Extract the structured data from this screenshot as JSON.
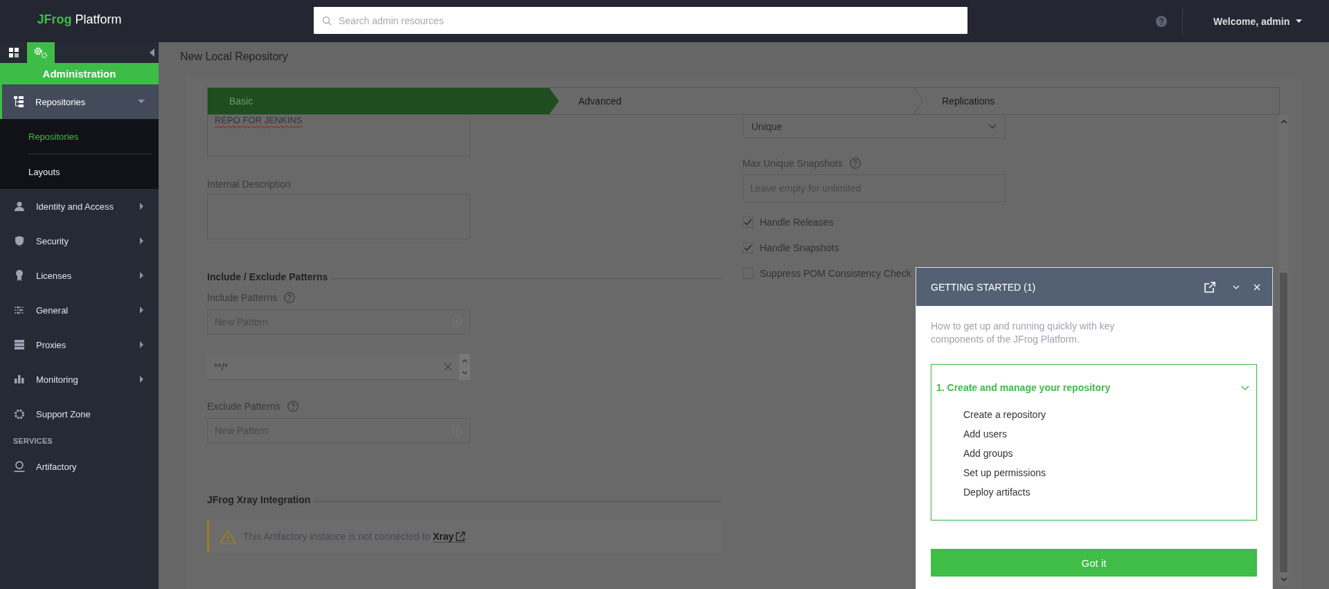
{
  "header": {
    "logo": {
      "brand": "JFrog",
      "product": "Platform"
    },
    "search": {
      "placeholder": "Search admin resources"
    },
    "user_menu": "Welcome, admin"
  },
  "sidebar": {
    "tabs": [
      {
        "kind": "dashboard",
        "selected": false
      },
      {
        "kind": "admin",
        "selected": true
      }
    ],
    "section_title": "Administration",
    "items": [
      {
        "label": "Repositories",
        "kind": "group",
        "expanded": true,
        "selected": true,
        "children": [
          {
            "label": "Repositories",
            "selected": true
          },
          {
            "label": "Layouts",
            "selected": false
          }
        ]
      },
      {
        "label": "Identity and Access",
        "kind": "group",
        "expanded": false,
        "selected": false
      },
      {
        "label": "Security",
        "kind": "group",
        "expanded": false,
        "selected": false
      },
      {
        "label": "Licenses",
        "kind": "group",
        "expanded": false,
        "selected": false
      },
      {
        "label": "General",
        "kind": "group",
        "expanded": false,
        "selected": false
      },
      {
        "label": "Proxies",
        "kind": "group",
        "expanded": false,
        "selected": false
      },
      {
        "label": "Monitoring",
        "kind": "group",
        "expanded": false,
        "selected": false
      },
      {
        "label": "Support Zone",
        "kind": "link",
        "selected": false
      }
    ],
    "services_title": "SERVICES",
    "services": [
      {
        "label": "Artifactory"
      }
    ]
  },
  "page_title": "New Local Repository",
  "steps": [
    {
      "label": "Basic",
      "selected": true
    },
    {
      "label": "Advanced",
      "selected": false
    },
    {
      "label": "Replications",
      "selected": false
    }
  ],
  "form": {
    "description": {
      "value": "REPO FOR JENKINS"
    },
    "internal_description": {
      "label": "Internal Description"
    },
    "patterns_section": "Include / Exclude Patterns",
    "include": {
      "label": "Include Patterns",
      "placeholder": "New Pattern",
      "patterns": [
        "**/*"
      ]
    },
    "exclude": {
      "label": "Exclude Patterns",
      "placeholder": "New Pattern"
    },
    "xray_section": "JFrog Xray Integration",
    "xray_warning": {
      "text": "This Artifactory instance is not connected to ",
      "link": "Xray",
      "after": "."
    },
    "snapshot_policy": {
      "value": "Unique"
    },
    "max_unique_snapshots": {
      "label": "Max Unique Snapshots",
      "placeholder": "Leave empty for unlimited"
    },
    "checkboxes": [
      {
        "label": "Handle Releases",
        "checked": true
      },
      {
        "label": "Handle Snapshots",
        "checked": true
      },
      {
        "label": "Suppress POM Consistency Check",
        "checked": false
      }
    ]
  },
  "getting_started": {
    "title": "GETTING STARTED (1)",
    "intro": "How to get up and running quickly with key components of the JFrog Platform.",
    "step": {
      "title": "1. Create and manage your repository",
      "expanded": true,
      "tasks": [
        "Create a repository",
        "Add users",
        "Add groups",
        "Set up permissions",
        "Deploy artifacts"
      ]
    },
    "button": "Got it"
  }
}
